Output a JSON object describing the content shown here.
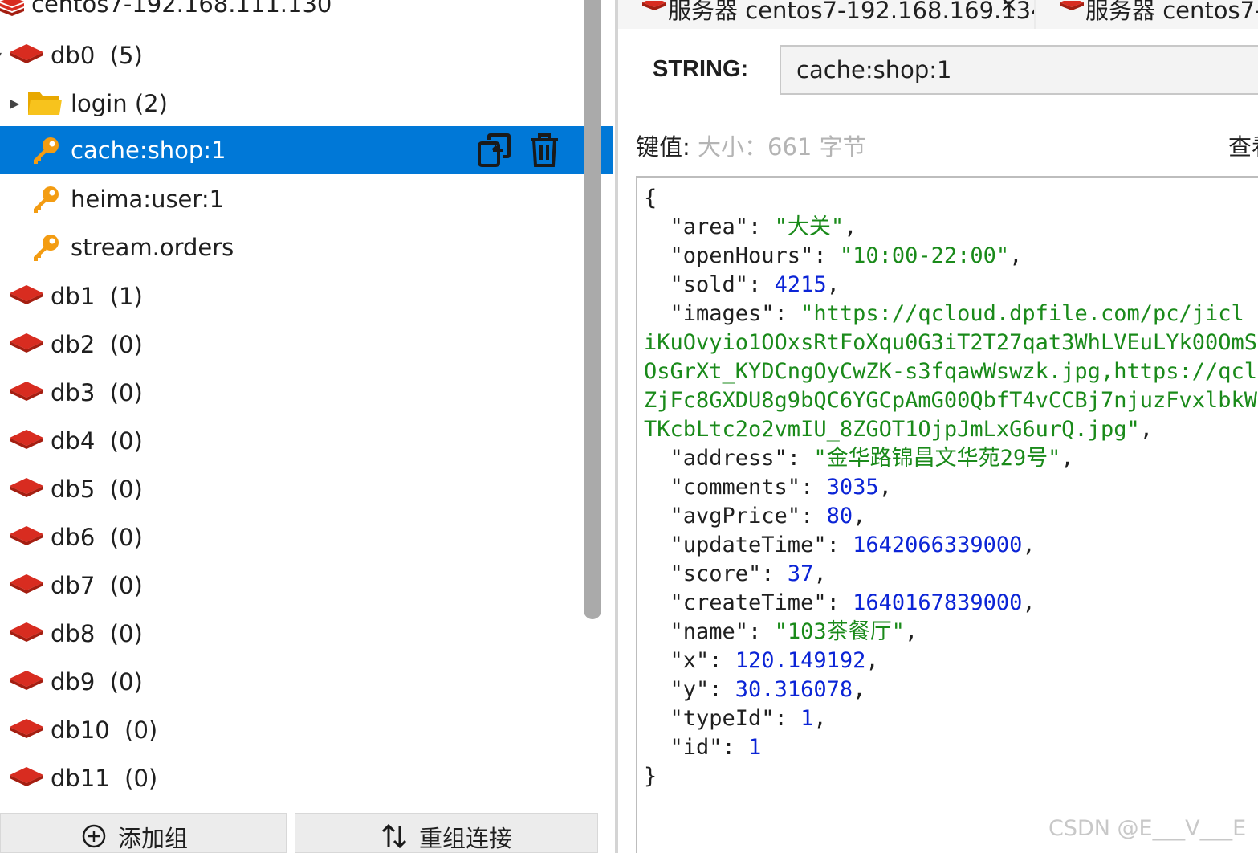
{
  "connection": {
    "name": "centos7-192.168.111.130"
  },
  "tree": {
    "db0": {
      "label": "db0  (5)"
    },
    "login_folder": {
      "label": "login (2)"
    },
    "keys": [
      {
        "label": "cache:shop:1",
        "selected": true
      },
      {
        "label": "heima:user:1",
        "selected": false
      },
      {
        "label": "stream.orders",
        "selected": false
      }
    ],
    "dbs": [
      {
        "label": "db1  (1)"
      },
      {
        "label": "db2  (0)"
      },
      {
        "label": "db3  (0)"
      },
      {
        "label": "db4  (0)"
      },
      {
        "label": "db5  (0)"
      },
      {
        "label": "db6  (0)"
      },
      {
        "label": "db7  (0)"
      },
      {
        "label": "db8  (0)"
      },
      {
        "label": "db9  (0)"
      },
      {
        "label": "db10  (0)"
      },
      {
        "label": "db11  (0)"
      }
    ]
  },
  "footer": {
    "add_group": "添加组",
    "regroup": "重组连接"
  },
  "tabs": [
    {
      "label": "服务器 centos7-192.168.169.134",
      "close": "×"
    },
    {
      "label": "服务器 centos7-"
    }
  ],
  "key_view": {
    "type_label": "STRING:",
    "key_name": "cache:shop:1",
    "value_label": "键值:",
    "size_text": "大小：661 字节",
    "view_as": "查看"
  },
  "json_lines": [
    [
      {
        "t": "p",
        "v": "{"
      }
    ],
    [
      {
        "t": "k",
        "v": "  \"area\": "
      },
      {
        "t": "s",
        "v": "\"大关\""
      },
      {
        "t": "p",
        "v": ","
      }
    ],
    [
      {
        "t": "k",
        "v": "  \"openHours\": "
      },
      {
        "t": "s",
        "v": "\"10:00-22:00\""
      },
      {
        "t": "p",
        "v": ","
      }
    ],
    [
      {
        "t": "k",
        "v": "  \"sold\": "
      },
      {
        "t": "n",
        "v": "4215"
      },
      {
        "t": "p",
        "v": ","
      }
    ],
    [
      {
        "t": "k",
        "v": "  \"images\": "
      },
      {
        "t": "s",
        "v": "\"https://qcloud.dpfile.com/pc/jicl"
      }
    ],
    [
      {
        "t": "s",
        "v": "iKuOvyio1OOxsRtFoXqu0G3iT2T27qat3WhLVEuLYk00OmS"
      }
    ],
    [
      {
        "t": "s",
        "v": "OsGrXt_KYDCngOyCwZK-s3fqawWswzk.jpg,https://qcl"
      }
    ],
    [
      {
        "t": "s",
        "v": "ZjFc8GXDU8g9bQC6YGCpAmG00QbfT4vCCBj7njuzFvxlbkW"
      }
    ],
    [
      {
        "t": "s",
        "v": "TKcbLtc2o2vmIU_8ZGOT1OjpJmLxG6urQ.jpg\""
      },
      {
        "t": "p",
        "v": ","
      }
    ],
    [
      {
        "t": "k",
        "v": "  \"address\": "
      },
      {
        "t": "s",
        "v": "\"金华路锦昌文华苑29号\""
      },
      {
        "t": "p",
        "v": ","
      }
    ],
    [
      {
        "t": "k",
        "v": "  \"comments\": "
      },
      {
        "t": "n",
        "v": "3035"
      },
      {
        "t": "p",
        "v": ","
      }
    ],
    [
      {
        "t": "k",
        "v": "  \"avgPrice\": "
      },
      {
        "t": "n",
        "v": "80"
      },
      {
        "t": "p",
        "v": ","
      }
    ],
    [
      {
        "t": "k",
        "v": "  \"updateTime\": "
      },
      {
        "t": "n",
        "v": "1642066339000"
      },
      {
        "t": "p",
        "v": ","
      }
    ],
    [
      {
        "t": "k",
        "v": "  \"score\": "
      },
      {
        "t": "n",
        "v": "37"
      },
      {
        "t": "p",
        "v": ","
      }
    ],
    [
      {
        "t": "k",
        "v": "  \"createTime\": "
      },
      {
        "t": "n",
        "v": "1640167839000"
      },
      {
        "t": "p",
        "v": ","
      }
    ],
    [
      {
        "t": "k",
        "v": "  \"name\": "
      },
      {
        "t": "s",
        "v": "\"103茶餐厅\""
      },
      {
        "t": "p",
        "v": ","
      }
    ],
    [
      {
        "t": "k",
        "v": "  \"x\": "
      },
      {
        "t": "n",
        "v": "120.149192"
      },
      {
        "t": "p",
        "v": ","
      }
    ],
    [
      {
        "t": "k",
        "v": "  \"y\": "
      },
      {
        "t": "n",
        "v": "30.316078"
      },
      {
        "t": "p",
        "v": ","
      }
    ],
    [
      {
        "t": "k",
        "v": "  \"typeId\": "
      },
      {
        "t": "n",
        "v": "1"
      },
      {
        "t": "p",
        "v": ","
      }
    ],
    [
      {
        "t": "k",
        "v": "  \"id\": "
      },
      {
        "t": "n",
        "v": "1"
      }
    ],
    [
      {
        "t": "p",
        "v": "}"
      }
    ]
  ],
  "watermark": "CSDN @E___V___E",
  "colors": {
    "selection": "#0078d7",
    "redis_red": "#d82c20",
    "key_orange": "#f39c12",
    "folder_yellow": "#f7c31d",
    "json_string": "#1a8a1a",
    "json_number": "#0b24d6"
  }
}
